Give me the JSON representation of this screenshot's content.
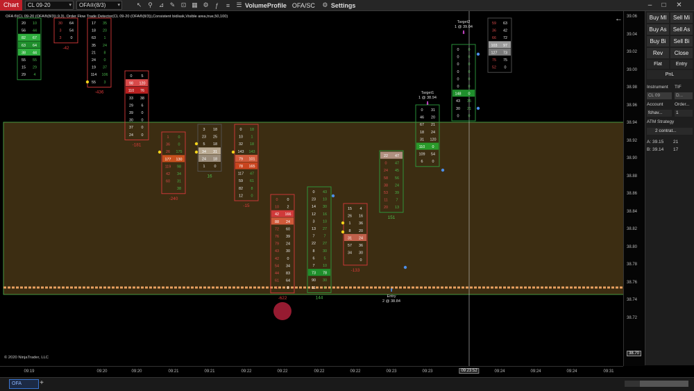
{
  "titlebar": {
    "chart_label": "Chart",
    "instrument": "CL 09-20",
    "period": "OFA®(8/3)",
    "volume_profile": "VolumeProfile",
    "ofa_sc": "OFA/SC",
    "settings": "Settings"
  },
  "indicator_label": "OFA ®(CL 09-20 (OFA®(8/3)),9,3),  Order Flow Trade Detector(CL 09-20 (OFA®(8/3)),Consistent bid/ask,Visible area,true,50,100)",
  "copyright": "© 2020 NinjaTrader, LLC",
  "price_axis": {
    "ticks": [
      "39.06",
      "39.04",
      "39.02",
      "39.00",
      "38.98",
      "38.96",
      "38.94",
      "38.92",
      "38.90",
      "38.88",
      "38.86",
      "38.84",
      "38.82",
      "38.80",
      "38.78",
      "38.76",
      "38.74",
      "38.72"
    ],
    "current": "38.70"
  },
  "time_axis": {
    "ticks": [
      "09:19",
      "09:20",
      "09:20",
      "09:21",
      "09:21",
      "09:22",
      "09:22",
      "09:22",
      "09:22",
      "09:23",
      "09:23",
      "09:23",
      "09:24",
      "09:24",
      "09:24",
      "09:31"
    ],
    "cursor": "09:23:52"
  },
  "panel": {
    "buy_mkt": "Buy Ml",
    "sell_mkt": "Sell Mi",
    "buy_ask": "Buy As",
    "sell_ask": "Sell As",
    "buy_bid": "Buy Bi",
    "sell_bid": "Sell Bi",
    "rev": "Rev",
    "close": "Close",
    "flat": "Flat",
    "entry": "Entry",
    "pnl": "PnL",
    "instrument_label": "Instrument",
    "tif_label": "TIF",
    "instrument_value": "CL 09",
    "tif_value": "D...",
    "account_label": "Account",
    "order_label": "Order...",
    "account_value": "fchav...",
    "order_qty": "1",
    "atm_label": "ATM Strategy",
    "atm_value": "2 contrat...",
    "ask_label": "A:",
    "ask_price": "39.15",
    "ask_qty": "21",
    "bid_label": "B:",
    "bid_price": "39.14",
    "bid_qty": "17"
  },
  "tabs": [
    "OFA"
  ],
  "markers": {
    "target2": "Target2",
    "target2_detail": "1 @ 39.04",
    "target1": "Target1",
    "target1_detail": "1 @ 38.94",
    "entry": "Entry",
    "entry_detail": "2 @ 38.84"
  },
  "colors": {
    "zone_fill": "#3c2d12",
    "zone_border": "#4fb84f",
    "price_line": "#e8a060",
    "bearish_box": "#d83a3a",
    "bullish_box": "#2e9e3e"
  },
  "chart_data": {
    "type": "table",
    "columns": [
      {
        "bid": [
          "20",
          "56",
          "82",
          "63",
          "38",
          "55",
          "15",
          "29"
        ],
        "ask": [
          "10",
          "44",
          "67",
          "64",
          "44",
          "55",
          "29",
          "4"
        ],
        "delta": ""
      },
      {
        "bid": [
          "30",
          "3",
          "3"
        ],
        "ask": [
          "64",
          "54",
          "0"
        ],
        "delta": "-42"
      },
      {
        "bid": [
          "17",
          "18",
          "63",
          "35",
          "21",
          "24",
          "19",
          "114",
          "55"
        ],
        "ask": [
          "35",
          "20",
          "1",
          "24",
          "8",
          "0",
          "37",
          "106",
          "3"
        ],
        "delta": "-436"
      },
      {
        "bid": [
          "0",
          "98",
          "110",
          "33",
          "29",
          "39",
          "30",
          "37",
          "24"
        ],
        "ask": [
          "5",
          "120",
          "76",
          "38",
          "6",
          "0",
          "0",
          "0",
          "0"
        ],
        "delta": "-181"
      },
      {
        "bid": [
          "1",
          "36",
          "26",
          "177",
          "119",
          "42",
          "60"
        ],
        "ask": [
          "0",
          "0",
          "175",
          "130",
          "98",
          "34",
          "31",
          "38"
        ],
        "delta": "-240"
      },
      {
        "bid": [
          "3",
          "23",
          "5",
          "34",
          "24",
          "1"
        ],
        "ask": [
          "18",
          "25",
          "18",
          "31",
          "18",
          "0"
        ],
        "delta": "16"
      },
      {
        "bid": [
          "0",
          "10",
          "32",
          "143",
          "79",
          "78",
          "117",
          "59",
          "82",
          "12"
        ],
        "ask": [
          "18",
          "1",
          "18",
          "143",
          "101",
          "165",
          "47",
          "61",
          "8",
          "0"
        ],
        "delta": "-15"
      },
      {
        "bid": [
          "0",
          "10",
          "42",
          "88",
          "72",
          "76",
          "79",
          "43",
          "42",
          "54",
          "44",
          "61",
          "1"
        ],
        "ask": [
          "0",
          "2",
          "166",
          "24",
          "60",
          "39",
          "24",
          "30",
          "0",
          "34",
          "83",
          "64",
          "8"
        ],
        "delta": "-622"
      },
      {
        "bid": [
          "0",
          "23",
          "14",
          "12",
          "3",
          "13",
          "7",
          "22",
          "8",
          "6",
          "7",
          "73",
          "90",
          "11"
        ],
        "ask": [
          "43",
          "10",
          "30",
          "16",
          "10",
          "27",
          "7",
          "27",
          "30",
          "5",
          "10",
          "78",
          "30",
          "0"
        ],
        "delta": "144"
      },
      {
        "bid": [
          "15",
          "26",
          "1",
          "8",
          "31",
          "57",
          "34"
        ],
        "ask": [
          "4",
          "16",
          "36",
          "20",
          "24",
          "36",
          "30",
          "0"
        ],
        "delta": "-133"
      },
      {
        "bid": [
          "22",
          "0",
          "24",
          "58",
          "38",
          "53",
          "11",
          "20"
        ],
        "ask": [
          "47",
          "47",
          "45",
          "56",
          "24",
          "39",
          "7",
          "13"
        ],
        "delta": "151"
      },
      {
        "bid": [
          "0",
          "46",
          "67",
          "18",
          "31",
          "110",
          "109",
          "6"
        ],
        "ask": [
          "31",
          "20",
          "21",
          "24",
          "120",
          "0",
          "54",
          "0"
        ],
        "delta": ""
      },
      {
        "bid": [
          "0",
          "0",
          "0",
          "0",
          "0",
          "0",
          "148",
          "43",
          "30",
          "0"
        ],
        "ask": [
          "0",
          "0",
          "0",
          "0",
          "0",
          "0",
          "0",
          "35",
          "21",
          "0"
        ],
        "delta": ""
      },
      {
        "bid": [
          "59",
          "36",
          "66",
          "103",
          "127",
          "75",
          "52"
        ],
        "ask": [
          "63",
          "42",
          "72",
          "97",
          "73",
          "75",
          "0"
        ],
        "delta": ""
      }
    ]
  }
}
